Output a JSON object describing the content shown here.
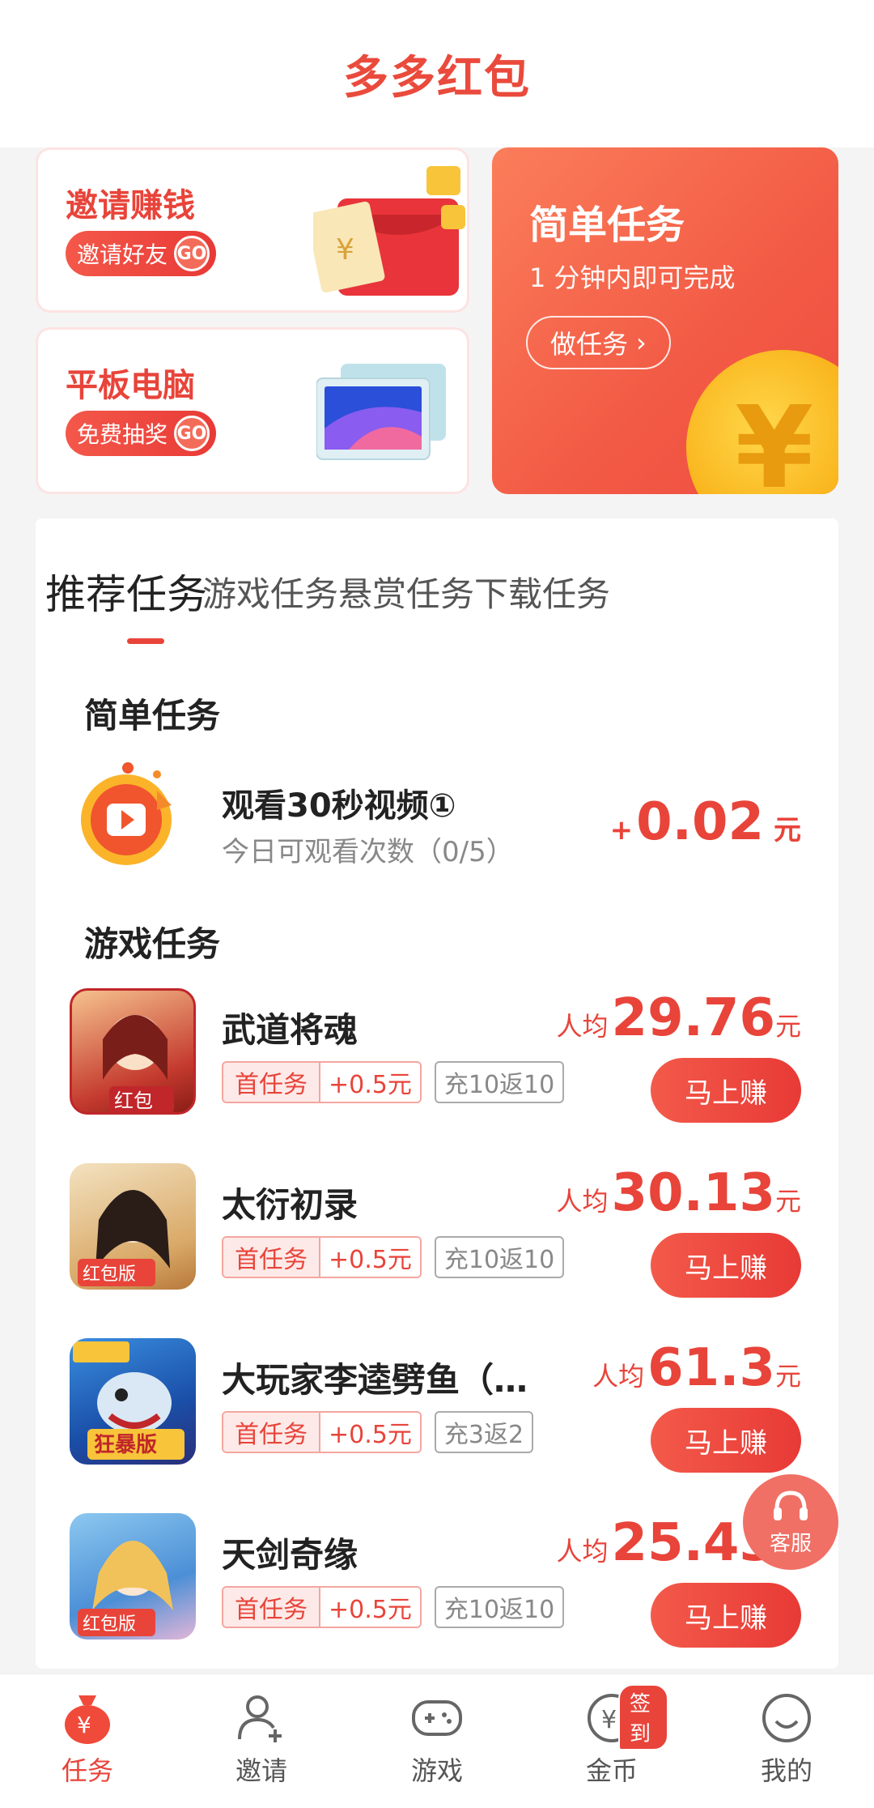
{
  "header": {
    "title": "多多红包"
  },
  "promos": {
    "invite": {
      "title": "邀请赚钱",
      "button": "邀请好友",
      "go": "GO"
    },
    "tablet": {
      "title": "平板电脑",
      "button": "免费抽奖",
      "go": "GO"
    },
    "simple": {
      "title": "简单任务",
      "subtitle": "1 分钟内即可完成",
      "button": "做任务",
      "chevron": "›",
      "coin_symbol": "¥"
    }
  },
  "tabs": [
    {
      "label": "推荐任务",
      "active": true
    },
    {
      "label": "游戏任务",
      "active": false
    },
    {
      "label": "悬赏任务",
      "active": false
    },
    {
      "label": "下载任务",
      "active": false
    }
  ],
  "sections": {
    "simple": "简单任务",
    "game": "游戏任务"
  },
  "video_task": {
    "name": "观看30秒视频①",
    "sub": "今日可观看次数（0/5）",
    "plus": "+",
    "amount": "0.02",
    "unit": "元"
  },
  "games": [
    {
      "name": "武道将魂",
      "tag1": "首任务",
      "tag2": "+0.5元",
      "tag3": "充10返10",
      "prefix": "人均",
      "price": "29.76",
      "unit": "元",
      "button": "马上赚",
      "icon": "game-wudao-icon",
      "icon_badge": "红包"
    },
    {
      "name": "太衍初录",
      "tag1": "首任务",
      "tag2": "+0.5元",
      "tag3": "充10返10",
      "prefix": "人均",
      "price": "30.13",
      "unit": "元",
      "button": "马上赚",
      "icon": "game-taiyan-icon",
      "icon_badge": "红包版"
    },
    {
      "name": "大玩家李逵劈鱼（…",
      "tag1": "首任务",
      "tag2": "+0.5元",
      "tag3": "充3返2",
      "prefix": "人均",
      "price": "61.3",
      "unit": "元",
      "button": "马上赚",
      "icon": "game-likui-icon",
      "icon_badge": "狂暴版"
    },
    {
      "name": "天剑奇缘",
      "tag1": "首任务",
      "tag2": "+0.5元",
      "tag3": "充10返10",
      "prefix": "人均",
      "price": "25.43",
      "unit": "元",
      "button": "马上赚",
      "icon": "game-tianjian-icon",
      "icon_badge": "红包版"
    }
  ],
  "service": {
    "label": "客服"
  },
  "nav": [
    {
      "label": "任务",
      "icon": "money-bag-icon",
      "active": true
    },
    {
      "label": "邀请",
      "icon": "add-user-icon",
      "active": false
    },
    {
      "label": "游戏",
      "icon": "gamepad-icon",
      "active": false
    },
    {
      "label": "金币",
      "icon": "coin-icon",
      "active": false,
      "badge": "签到"
    },
    {
      "label": "我的",
      "icon": "smile-icon",
      "active": false
    }
  ],
  "colors": {
    "accent": "#e8443a",
    "card_orange": "#f25a45",
    "coin": "#f9b31a"
  }
}
